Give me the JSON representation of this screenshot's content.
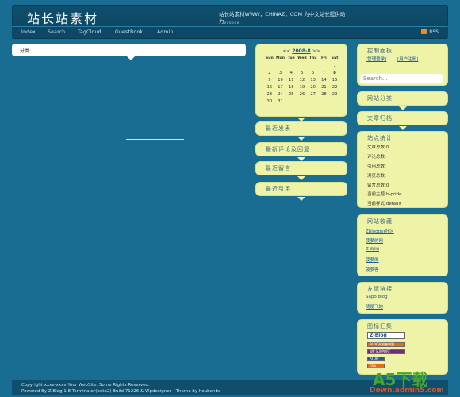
{
  "header": {
    "title": "站长站素材",
    "description": "站长站素材WWW，CHINAZ，COM 为中文站长提供动力。。。。。。"
  },
  "nav": {
    "items": [
      "Index",
      "Search",
      "TagCloud",
      "GuestBook",
      "Admin"
    ],
    "rss": "RSS"
  },
  "content": {
    "category_label": "分类:"
  },
  "calendar": {
    "prev": "<<",
    "month": "2008-8",
    "next": ">>",
    "weekdays": [
      "Sun",
      "Mon",
      "Tue",
      "Wed",
      "Thu",
      "Fri",
      "Sat"
    ],
    "weeks": [
      [
        "",
        "",
        "",
        "",
        "",
        "",
        "1"
      ],
      [
        "2",
        "3",
        "4",
        "5",
        "6",
        "7",
        "8"
      ],
      [
        "9",
        "10",
        "11",
        "12",
        "13",
        "14",
        "15"
      ],
      [
        "16",
        "17",
        "18",
        "19",
        "20",
        "21",
        "22"
      ],
      [
        "23",
        "24",
        "25",
        "26",
        "27",
        "28",
        "29"
      ],
      [
        "30",
        "31",
        "",
        "",
        "",
        "",
        ""
      ]
    ]
  },
  "middle_widgets": [
    "最近发表",
    "最新评论及回复",
    "最近留言",
    "最近引用"
  ],
  "control_panel": {
    "title": "控制面板",
    "login": "[管理登录]",
    "register": "[用户注册]"
  },
  "search": {
    "placeholder": "Search..."
  },
  "categories": {
    "title": "网站分类"
  },
  "archives": {
    "title": "文章归档"
  },
  "stats": {
    "title": "站点统计",
    "lines": [
      "文章总数:0",
      "评论总数:",
      "引用总数:",
      "浏览总数:",
      "留言总数:0",
      "当前主题:h-pride",
      "当前样式:default"
    ]
  },
  "favorites": {
    "title": "网站收藏",
    "links": [
      "Zblogger社区",
      "菠萝的网",
      "Z-Wiki",
      "菠萝阁",
      "菠萝客"
    ]
  },
  "friends": {
    "title": "友情链接",
    "links": [
      "Sapo Blog",
      "随便飞的"
    ]
  },
  "badges": {
    "title": "图标汇集",
    "items": [
      "Z-Blog",
      "BLOG开发者联盟",
      "WP SUPPORT",
      "ATOM",
      "RSS"
    ]
  },
  "footer": {
    "line1": "Copyright xxxx-xxxx Your WebSite. Some Rights Reserved.",
    "line2": "Powered By Z-Blog 1.8 Terminator(beta2) Build 71226 & Wpdesigner",
    "line2b": "Theme by houbenbo"
  },
  "watermark": {
    "top": "A5下载",
    "bottom": "Down.admin5.com"
  }
}
